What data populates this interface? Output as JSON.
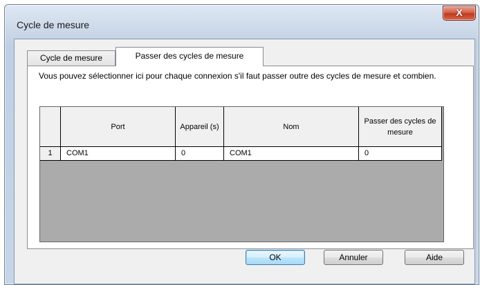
{
  "window": {
    "title": "Cycle de mesure",
    "close_label": "X"
  },
  "tabs": [
    {
      "label": "Cycle de mesure",
      "active": false
    },
    {
      "label": "Passer des cycles de mesure",
      "active": true
    }
  ],
  "panel": {
    "description": "Vous pouvez sélectionner ici pour chaque connexion s'il faut passer outre des cycles de mesure et combien."
  },
  "table": {
    "headers": [
      "Port",
      "Appareil (s)",
      "Nom",
      "Passer des cycles de mesure"
    ],
    "rows": [
      {
        "num": "1",
        "port": "COM1",
        "device": "0",
        "name": "COM1",
        "skip": "0"
      }
    ]
  },
  "buttons": {
    "ok": "OK",
    "cancel": "Annuler",
    "help": "Aide"
  },
  "colors": {
    "ok_border": "#3c7fb1",
    "close_red": "#c0391f"
  }
}
